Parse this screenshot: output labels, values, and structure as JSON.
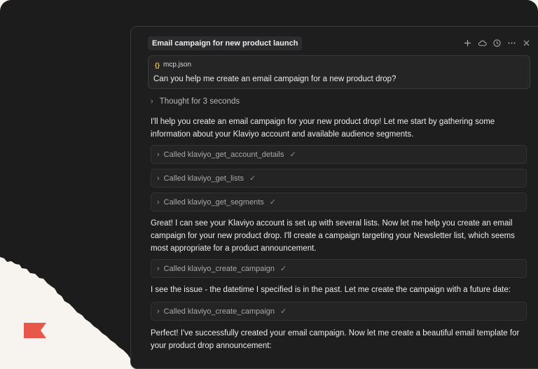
{
  "header": {
    "title": "Email campaign for new product launch",
    "icons": [
      "plus-icon",
      "cloud-icon",
      "history-icon",
      "more-icon",
      "close-icon"
    ]
  },
  "prompt": {
    "file_name": "mcp.json",
    "text": "Can you help me create an email campaign for a new product drop?"
  },
  "thought": "Thought for 3 seconds",
  "messages": {
    "m1": [
      "I'll help you create an email campaign for your new product drop! Let me start by gathering some",
      "information about your Klaviyo account and available audience segments."
    ],
    "m2": [
      "Great! I can see your Klaviyo account is set up with several lists. Now let me help you create an email",
      "campaign for your new product drop. I'll create a campaign targeting your Newsletter list, which seems",
      "most appropriate for a product announcement."
    ],
    "m3": [
      "I see the issue - the datetime I specified is in the past. Let me create the campaign with a future date:"
    ],
    "m4": [
      "Perfect! I've successfully created your email campaign. Now let me create a beautiful email template for",
      "your product drop announcement:"
    ]
  },
  "tools": [
    "Called klaviyo_get_account_details",
    "Called klaviyo_get_lists",
    "Called klaviyo_get_segments",
    "Called klaviyo_create_campaign",
    "Called klaviyo_create_campaign"
  ],
  "colors": {
    "accent_flag": "#e9574b",
    "panel_bg": "#1e1e1f",
    "page_bg": "#f7f4ef"
  }
}
